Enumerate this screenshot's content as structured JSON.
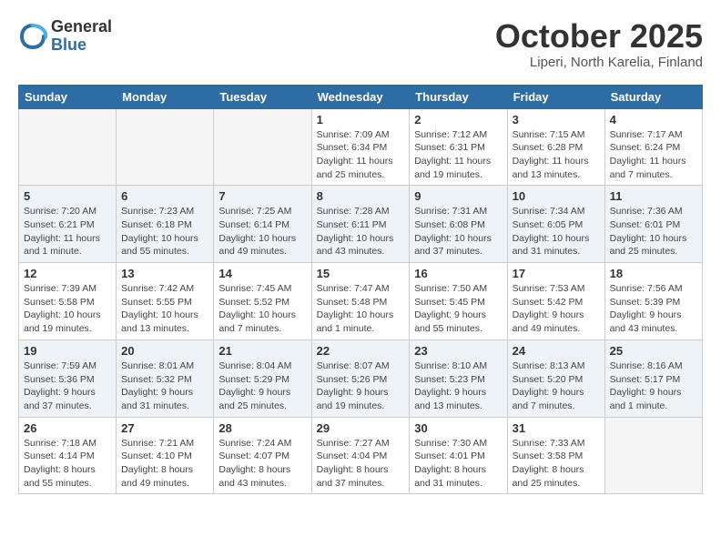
{
  "logo": {
    "general": "General",
    "blue": "Blue"
  },
  "title": "October 2025",
  "subtitle": "Liperi, North Karelia, Finland",
  "days": [
    "Sunday",
    "Monday",
    "Tuesday",
    "Wednesday",
    "Thursday",
    "Friday",
    "Saturday"
  ],
  "weeks": [
    [
      {
        "num": "",
        "info": ""
      },
      {
        "num": "",
        "info": ""
      },
      {
        "num": "",
        "info": ""
      },
      {
        "num": "1",
        "info": "Sunrise: 7:09 AM\nSunset: 6:34 PM\nDaylight: 11 hours\nand 25 minutes."
      },
      {
        "num": "2",
        "info": "Sunrise: 7:12 AM\nSunset: 6:31 PM\nDaylight: 11 hours\nand 19 minutes."
      },
      {
        "num": "3",
        "info": "Sunrise: 7:15 AM\nSunset: 6:28 PM\nDaylight: 11 hours\nand 13 minutes."
      },
      {
        "num": "4",
        "info": "Sunrise: 7:17 AM\nSunset: 6:24 PM\nDaylight: 11 hours\nand 7 minutes."
      }
    ],
    [
      {
        "num": "5",
        "info": "Sunrise: 7:20 AM\nSunset: 6:21 PM\nDaylight: 11 hours\nand 1 minute."
      },
      {
        "num": "6",
        "info": "Sunrise: 7:23 AM\nSunset: 6:18 PM\nDaylight: 10 hours\nand 55 minutes."
      },
      {
        "num": "7",
        "info": "Sunrise: 7:25 AM\nSunset: 6:14 PM\nDaylight: 10 hours\nand 49 minutes."
      },
      {
        "num": "8",
        "info": "Sunrise: 7:28 AM\nSunset: 6:11 PM\nDaylight: 10 hours\nand 43 minutes."
      },
      {
        "num": "9",
        "info": "Sunrise: 7:31 AM\nSunset: 6:08 PM\nDaylight: 10 hours\nand 37 minutes."
      },
      {
        "num": "10",
        "info": "Sunrise: 7:34 AM\nSunset: 6:05 PM\nDaylight: 10 hours\nand 31 minutes."
      },
      {
        "num": "11",
        "info": "Sunrise: 7:36 AM\nSunset: 6:01 PM\nDaylight: 10 hours\nand 25 minutes."
      }
    ],
    [
      {
        "num": "12",
        "info": "Sunrise: 7:39 AM\nSunset: 5:58 PM\nDaylight: 10 hours\nand 19 minutes."
      },
      {
        "num": "13",
        "info": "Sunrise: 7:42 AM\nSunset: 5:55 PM\nDaylight: 10 hours\nand 13 minutes."
      },
      {
        "num": "14",
        "info": "Sunrise: 7:45 AM\nSunset: 5:52 PM\nDaylight: 10 hours\nand 7 minutes."
      },
      {
        "num": "15",
        "info": "Sunrise: 7:47 AM\nSunset: 5:48 PM\nDaylight: 10 hours\nand 1 minute."
      },
      {
        "num": "16",
        "info": "Sunrise: 7:50 AM\nSunset: 5:45 PM\nDaylight: 9 hours\nand 55 minutes."
      },
      {
        "num": "17",
        "info": "Sunrise: 7:53 AM\nSunset: 5:42 PM\nDaylight: 9 hours\nand 49 minutes."
      },
      {
        "num": "18",
        "info": "Sunrise: 7:56 AM\nSunset: 5:39 PM\nDaylight: 9 hours\nand 43 minutes."
      }
    ],
    [
      {
        "num": "19",
        "info": "Sunrise: 7:59 AM\nSunset: 5:36 PM\nDaylight: 9 hours\nand 37 minutes."
      },
      {
        "num": "20",
        "info": "Sunrise: 8:01 AM\nSunset: 5:32 PM\nDaylight: 9 hours\nand 31 minutes."
      },
      {
        "num": "21",
        "info": "Sunrise: 8:04 AM\nSunset: 5:29 PM\nDaylight: 9 hours\nand 25 minutes."
      },
      {
        "num": "22",
        "info": "Sunrise: 8:07 AM\nSunset: 5:26 PM\nDaylight: 9 hours\nand 19 minutes."
      },
      {
        "num": "23",
        "info": "Sunrise: 8:10 AM\nSunset: 5:23 PM\nDaylight: 9 hours\nand 13 minutes."
      },
      {
        "num": "24",
        "info": "Sunrise: 8:13 AM\nSunset: 5:20 PM\nDaylight: 9 hours\nand 7 minutes."
      },
      {
        "num": "25",
        "info": "Sunrise: 8:16 AM\nSunset: 5:17 PM\nDaylight: 9 hours\nand 1 minute."
      }
    ],
    [
      {
        "num": "26",
        "info": "Sunrise: 7:18 AM\nSunset: 4:14 PM\nDaylight: 8 hours\nand 55 minutes."
      },
      {
        "num": "27",
        "info": "Sunrise: 7:21 AM\nSunset: 4:10 PM\nDaylight: 8 hours\nand 49 minutes."
      },
      {
        "num": "28",
        "info": "Sunrise: 7:24 AM\nSunset: 4:07 PM\nDaylight: 8 hours\nand 43 minutes."
      },
      {
        "num": "29",
        "info": "Sunrise: 7:27 AM\nSunset: 4:04 PM\nDaylight: 8 hours\nand 37 minutes."
      },
      {
        "num": "30",
        "info": "Sunrise: 7:30 AM\nSunset: 4:01 PM\nDaylight: 8 hours\nand 31 minutes."
      },
      {
        "num": "31",
        "info": "Sunrise: 7:33 AM\nSunset: 3:58 PM\nDaylight: 8 hours\nand 25 minutes."
      },
      {
        "num": "",
        "info": ""
      }
    ]
  ]
}
